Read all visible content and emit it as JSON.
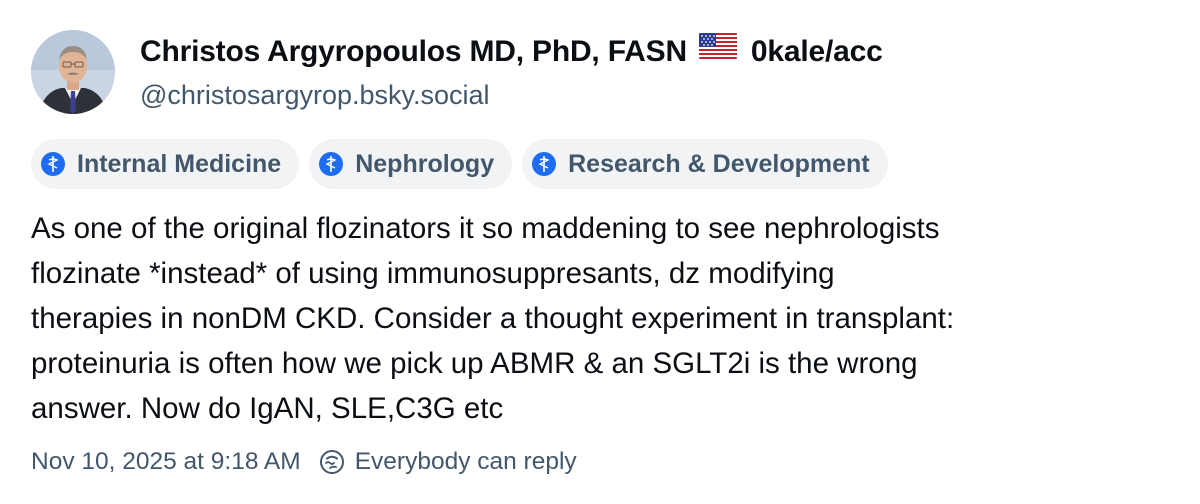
{
  "author": {
    "display_name": "Christos Argyropoulos MD, PhD, FASN",
    "flag_icon": "us-flag-icon",
    "name_suffix": "0kale/acc",
    "handle": "@christosargyrop.bsky.social",
    "avatar_icon": "profile-photo"
  },
  "badges": [
    {
      "label": "Internal Medicine",
      "icon": "medical-staff-icon"
    },
    {
      "label": "Nephrology",
      "icon": "medical-staff-icon"
    },
    {
      "label": "Research & Development",
      "icon": "medical-staff-icon"
    }
  ],
  "post": {
    "text_lines": [
      "As one of the original flozinators it so maddening to see nephrologists",
      "flozinate *instead* of using immunosuppresants, dz modifying",
      "therapies in nonDM CKD. Consider a thought experiment in transplant:",
      "proteinuria is often how we pick up ABMR & an SGLT2i is the wrong",
      "answer. Now do IgAN, SLE,C3G etc"
    ]
  },
  "footer": {
    "timestamp": "Nov 10, 2025 at 9:18 AM",
    "reply_setting": "Everybody can reply",
    "reply_icon": "reply-settings-icon"
  },
  "colors": {
    "badge_icon": "#1e6cf2",
    "muted_text": "#42576c",
    "badge_bg": "#f1f3f5"
  }
}
